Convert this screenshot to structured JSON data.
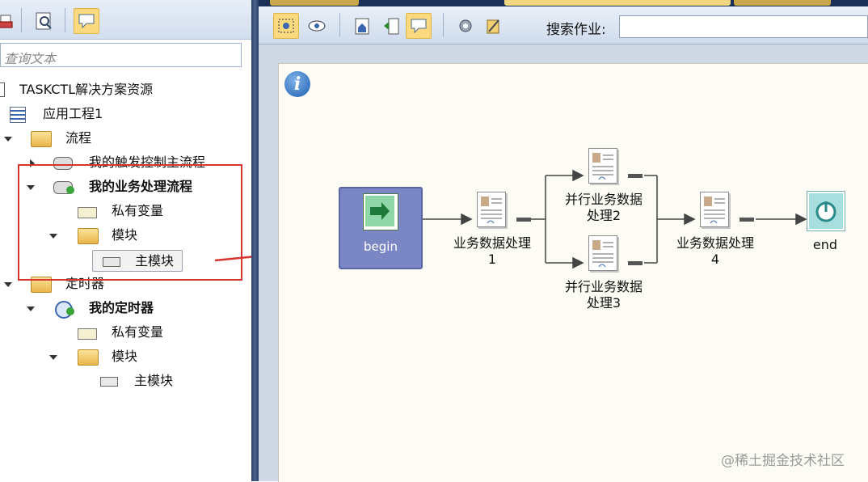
{
  "left_panel": {
    "search_placeholder": "查询文本",
    "tree": {
      "root": "TASKCTL解决方案资源",
      "project": "应用工程1",
      "flow_folder": "流程",
      "trigger_flow": "我的触发控制主流程",
      "business_flow": "我的业务处理流程",
      "private_vars": "私有变量",
      "module_folder": "模块",
      "main_module": "主模块",
      "timer_folder": "定时器",
      "my_timer": "我的定时器",
      "timer_private_vars": "私有变量",
      "timer_module_folder": "模块",
      "timer_main_module": "主模块"
    }
  },
  "right_panel": {
    "search_job_label": "搜索作业:",
    "search_job_value": "",
    "flow": {
      "begin_label": "begin",
      "end_label": "end",
      "job1_line1": "业务数据处理",
      "job1_line2": "1",
      "job2_line1": "并行业务数据",
      "job2_line2": "处理2",
      "job3_line1": "并行业务数据",
      "job3_line2": "处理3",
      "job4_line1": "业务数据处理",
      "job4_line2": "4"
    }
  },
  "watermark": "@稀土掘金技术社区",
  "colors": {
    "highlight": "#d9352f",
    "begin_node": "#7b86c4",
    "canvas": "#fdfcf4",
    "toolbar_active": "#fbd97e"
  },
  "icons": [
    "print-icon",
    "preview-icon",
    "comment-icon",
    "select-icon",
    "view-icon",
    "home-icon",
    "back-icon",
    "settings-icon",
    "tool-icon",
    "info-icon",
    "arrow-right-icon",
    "power-icon",
    "document-icon",
    "folder-icon",
    "gear-icon",
    "timer-icon"
  ]
}
